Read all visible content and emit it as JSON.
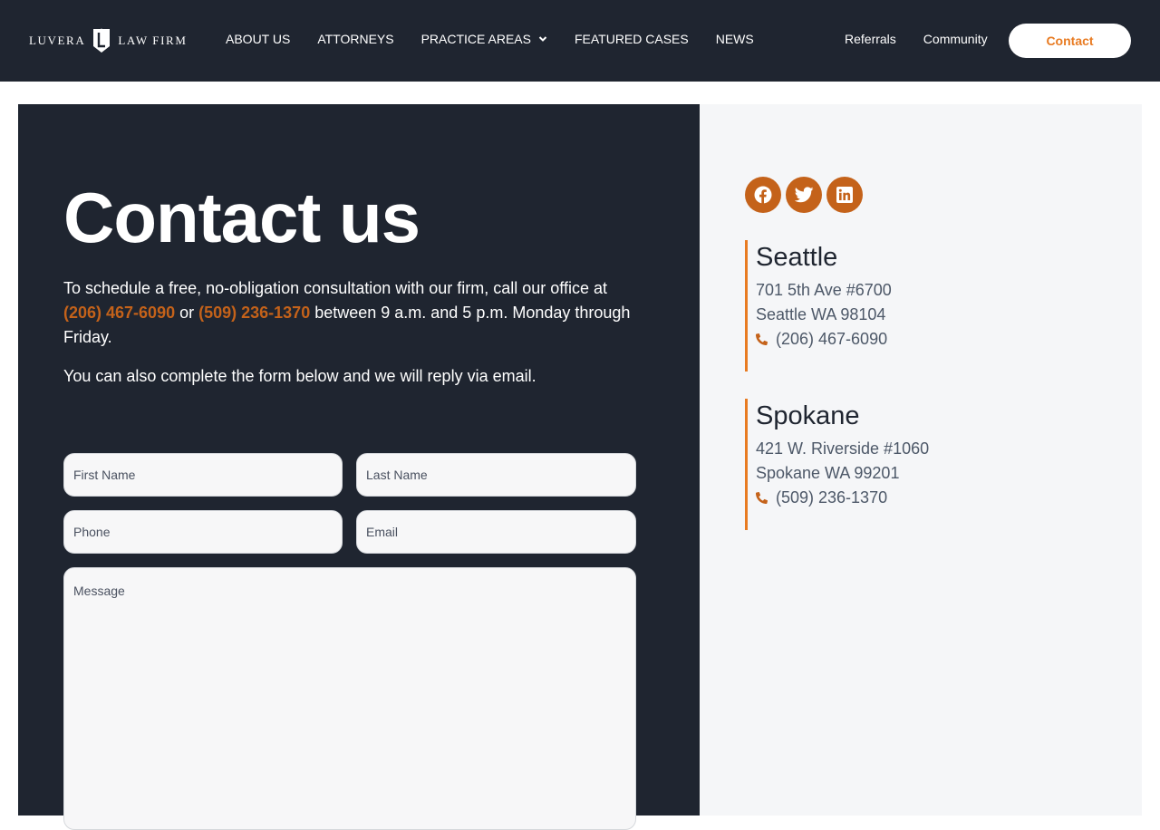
{
  "header": {
    "logo_left": "LUVERA",
    "logo_right": "LAW FIRM",
    "nav": [
      "ABOUT US",
      "ATTORNEYS",
      "PRACTICE AREAS",
      "FEATURED CASES",
      "NEWS"
    ],
    "nav_right": [
      "Referrals",
      "Community"
    ],
    "contact_label": "Contact"
  },
  "main": {
    "title": "Contact us",
    "intro": {
      "before": "To schedule a free, no-obligation consultation with our firm, call our office at ",
      "phone1": "(206) 467-6090",
      "mid": " or ",
      "phone2": "(509) 236-1370",
      "after": " between 9 a.m. and 5 p.m. Monday through Friday."
    },
    "intro2": "You can also complete the form below and we will reply via email.",
    "form": {
      "first_name": "First Name",
      "last_name": "Last Name",
      "phone": "Phone",
      "email": "Email",
      "message": "Message"
    }
  },
  "sidebar": {
    "social": [
      "facebook-icon",
      "twitter-icon",
      "linkedin-icon"
    ],
    "offices": [
      {
        "city": "Seattle",
        "line1": "701 5th Ave #6700",
        "line2": "Seattle WA 98104",
        "phone": "(206) 467-6090"
      },
      {
        "city": "Spokane",
        "line1": "421 W. Riverside #1060",
        "line2": "Spokane WA 99201",
        "phone": "(509) 236-1370"
      }
    ]
  },
  "colors": {
    "dark": "#1f2530",
    "accent": "#e87b22",
    "accent_dark": "#c4621a",
    "panel_light": "#f5f6f8"
  }
}
